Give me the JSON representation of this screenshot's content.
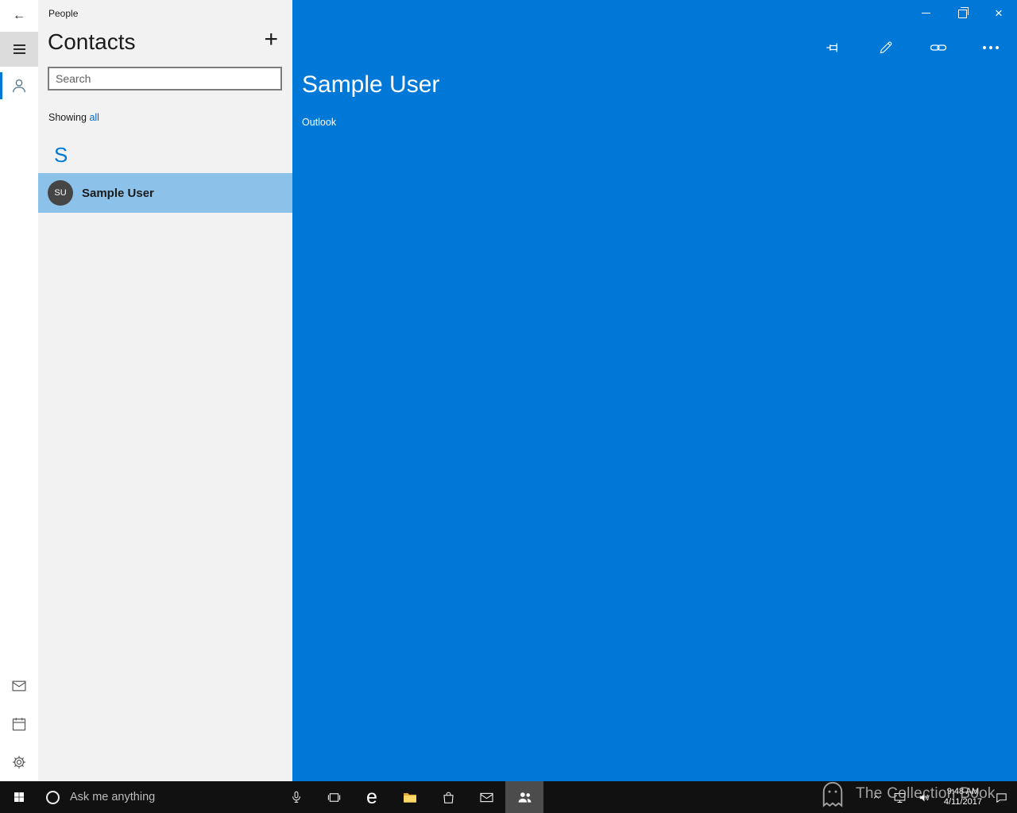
{
  "titlebar": {
    "back_icon": "←",
    "title": "People"
  },
  "contacts_panel": {
    "heading": "Contacts",
    "add_icon": "+",
    "search_placeholder": "Search",
    "showing_label": "Showing",
    "filter_value": "all",
    "section_letter": "S",
    "contacts": [
      {
        "initials": "SU",
        "name": "Sample User"
      }
    ]
  },
  "detail_pane": {
    "name": "Sample User",
    "account_source": "Outlook"
  },
  "window_controls": {
    "close_icon": "×"
  },
  "taskbar": {
    "search_placeholder": "Ask me anything",
    "edge_glyph": "e",
    "clock": {
      "time": "9:48 AM",
      "date": "4/11/2017"
    }
  },
  "watermark": {
    "text": "The Collection Book"
  },
  "colors": {
    "accent": "#0078d7",
    "selection_highlight": "#8cc2e9",
    "panel_background": "#f2f2f2",
    "taskbar_background": "#111111"
  }
}
